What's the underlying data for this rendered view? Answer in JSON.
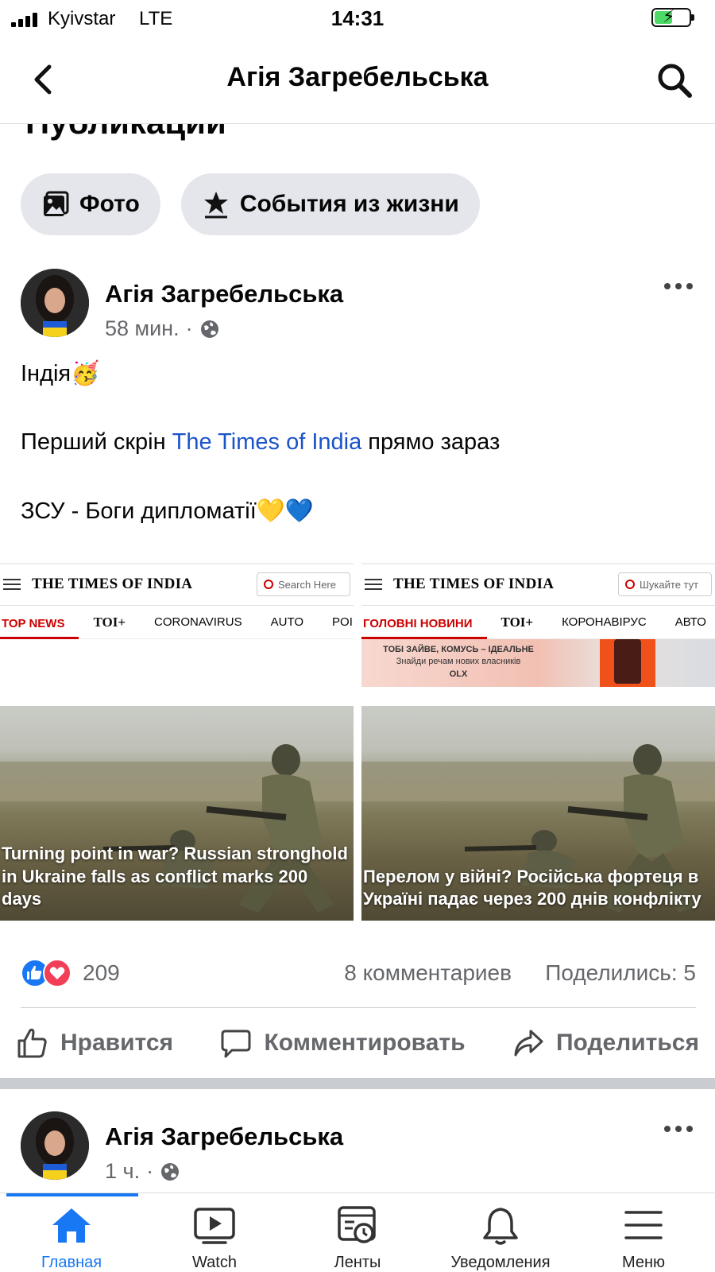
{
  "status": {
    "carrier": "Kyivstar",
    "network": "LTE",
    "time": "14:31"
  },
  "header": {
    "title": "Агія Загребельська"
  },
  "section": {
    "title": "Публикации"
  },
  "chips": [
    {
      "label": "Фото",
      "icon": "photo-icon"
    },
    {
      "label": "События из жизни",
      "icon": "life-event-icon"
    }
  ],
  "post": {
    "author": "Агія Загребельська",
    "time": "58 мин.",
    "separator": "·",
    "audience_icon": "globe-icon",
    "line1": "Індія🥳",
    "line2_prefix": "Перший скрін ",
    "line2_link": "The Times of India",
    "line2_suffix": " прямо зараз",
    "line3": "ЗСУ - Боги дипломатії💛💙",
    "screenshots": [
      {
        "logo": "THE TIMES OF INDIA",
        "search": "Search Here",
        "nav": [
          "TOP NEWS",
          "TOI+",
          "CORONAVIRUS",
          "AUTO",
          "POI"
        ],
        "caption": "Turning point in war? Russian stronghold in Ukraine falls as conflict marks 200 days"
      },
      {
        "logo": "THE TIMES OF INDIA",
        "search": "Шукайте тут",
        "nav": [
          "ГОЛОВНІ НОВИНИ",
          "TOI+",
          "КОРОНАВІРУС",
          "АВТО"
        ],
        "ad_line1": "ТОБІ ЗАЙВЕ, КОМУСЬ – ІДЕАЛЬНЕ",
        "ad_line2": "Знайди речам нових власників",
        "ad_brand": "OLX",
        "caption": "Перелом у війні? Російська фортеця в Україні падає через 200 днів конфлікту"
      }
    ],
    "reactions_count": "209",
    "comments": "8 комментариев",
    "shares": "Поделились: 5",
    "actions": {
      "like": "Нравится",
      "comment": "Комментировать",
      "share": "Поделиться"
    }
  },
  "post2": {
    "author": "Агія Загребельська",
    "time": "1 ч.",
    "separator": "·"
  },
  "bottom_nav": [
    {
      "label": "Главная",
      "icon": "home-icon",
      "active": true
    },
    {
      "label": "Watch",
      "icon": "watch-icon",
      "active": false
    },
    {
      "label": "Ленты",
      "icon": "feeds-icon",
      "active": false
    },
    {
      "label": "Уведомления",
      "icon": "bell-icon",
      "active": false
    },
    {
      "label": "Меню",
      "icon": "menu-icon",
      "active": false
    }
  ],
  "colors": {
    "accent": "#1877f2",
    "link": "#1b54c9",
    "secondary_text": "#65676b",
    "chip_bg": "#e4e6eb",
    "toi_red": "#cc0000"
  }
}
